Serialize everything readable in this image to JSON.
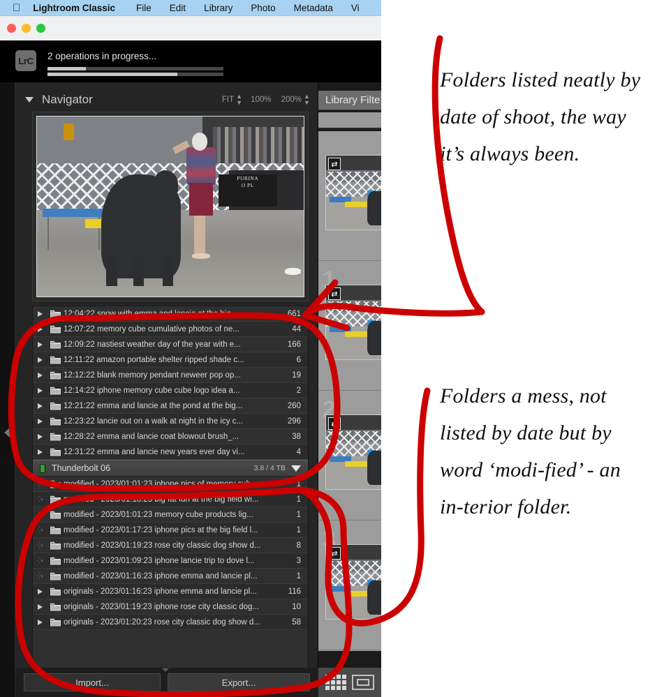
{
  "menubar": {
    "apple_icon": "apple-logo",
    "items": [
      "Lightroom Classic",
      "File",
      "Edit",
      "Library",
      "Photo",
      "Metadata",
      "Vi"
    ]
  },
  "window": {
    "traffic_lights": [
      "close",
      "minimize",
      "zoom"
    ]
  },
  "identity": {
    "badge": "LrC",
    "progress_label": "2 operations in progress...",
    "progress1_pct": 22,
    "progress2_pct": 74
  },
  "navigator": {
    "title": "Navigator",
    "zoom_fit": "FIT",
    "zoom_100": "100%",
    "zoom_200": "200%"
  },
  "folders": {
    "top_rows": [
      {
        "disclosure": "triangle",
        "name": "12:04:22 snow with emma and lancie at the big...",
        "count": "661"
      },
      {
        "disclosure": "triangle",
        "name": "12:07:22 memory cube cumulative photos of ne...",
        "count": "44"
      },
      {
        "disclosure": "triangle",
        "name": "12:09:22 nastiest weather day of the year with e...",
        "count": "166"
      },
      {
        "disclosure": "triangle",
        "name": "12:11:22 amazon portable shelter ripped shade c...",
        "count": "6"
      },
      {
        "disclosure": "triangle",
        "name": "12:12:22 blank memory pendant neweer pop op...",
        "count": "19"
      },
      {
        "disclosure": "triangle",
        "name": "12:14:22 iphone memory cube cube logo idea a...",
        "count": "2"
      },
      {
        "disclosure": "triangle",
        "name": "12:21:22 emma and lancie at the pond at the big...",
        "count": "260"
      },
      {
        "disclosure": "triangle",
        "name": "12:23:22 lancie out on a walk at night in the icy c...",
        "count": "296"
      },
      {
        "disclosure": "triangle",
        "name": "12:28:22 emma and lancie coat blowout brush_...",
        "count": "38"
      },
      {
        "disclosure": "triangle",
        "name": "12:31:22 emma and lancie new years ever day vi...",
        "count": "4"
      }
    ],
    "volume": {
      "led": "green",
      "name": "Thunderbolt 06",
      "size": "3.8 / 4 TB",
      "collapse": "triangle-down"
    },
    "bottom_rows": [
      {
        "disclosure": "dots",
        "name": "modified - 2023/01:01:23 iphone pics of memory cub...",
        "count": "1"
      },
      {
        "disclosure": "dots",
        "name": "modified - 2023/01:18:23 big fat fun at the big field wi...",
        "count": "1"
      },
      {
        "disclosure": "dots",
        "name": "modified - 2023/01:01:23 memory cube products lig...",
        "count": "1"
      },
      {
        "disclosure": "dots",
        "name": "modified - 2023/01:17:23 iphone pics at the big field l...",
        "count": "1"
      },
      {
        "disclosure": "dots",
        "name": "modified - 2023/01:19:23 rose city classic dog show d...",
        "count": "8"
      },
      {
        "disclosure": "dots",
        "name": "modified - 2023/01:09:23 iphone lancie trip to dove l...",
        "count": "3"
      },
      {
        "disclosure": "dots",
        "name": "modified - 2023/01:16:23 iphone emma and lancie pl...",
        "count": "1"
      },
      {
        "disclosure": "triangle",
        "name": "originals - 2023/01:16:23 iphone emma and lancie pl...",
        "count": "116"
      },
      {
        "disclosure": "triangle",
        "name": "originals - 2023/01:19:23 iphone rose city classic dog...",
        "count": "10"
      },
      {
        "disclosure": "triangle",
        "name": "originals - 2023/01:20:23 rose city classic dog show d...",
        "count": "58"
      }
    ]
  },
  "bottom_bar": {
    "import_label": "Import...",
    "export_label": "Export..."
  },
  "center": {
    "library_filter_label": "Library Filte",
    "cell_indices": [
      "",
      "1",
      "2",
      "3"
    ],
    "toolbar": {
      "grid_view": "grid-view-icon",
      "loupe_view": "loupe-view-icon"
    }
  },
  "photo": {
    "sign_line1": "PURINA",
    "sign_line2": "O PL"
  },
  "annotations": {
    "ink_color": "#cc0000",
    "note1": "Folders listed neatly by date of shoot, the way it’s always been.",
    "note2": "Folders a mess, not listed by date but by word ‘modi-fied’ - an in-terior folder."
  }
}
